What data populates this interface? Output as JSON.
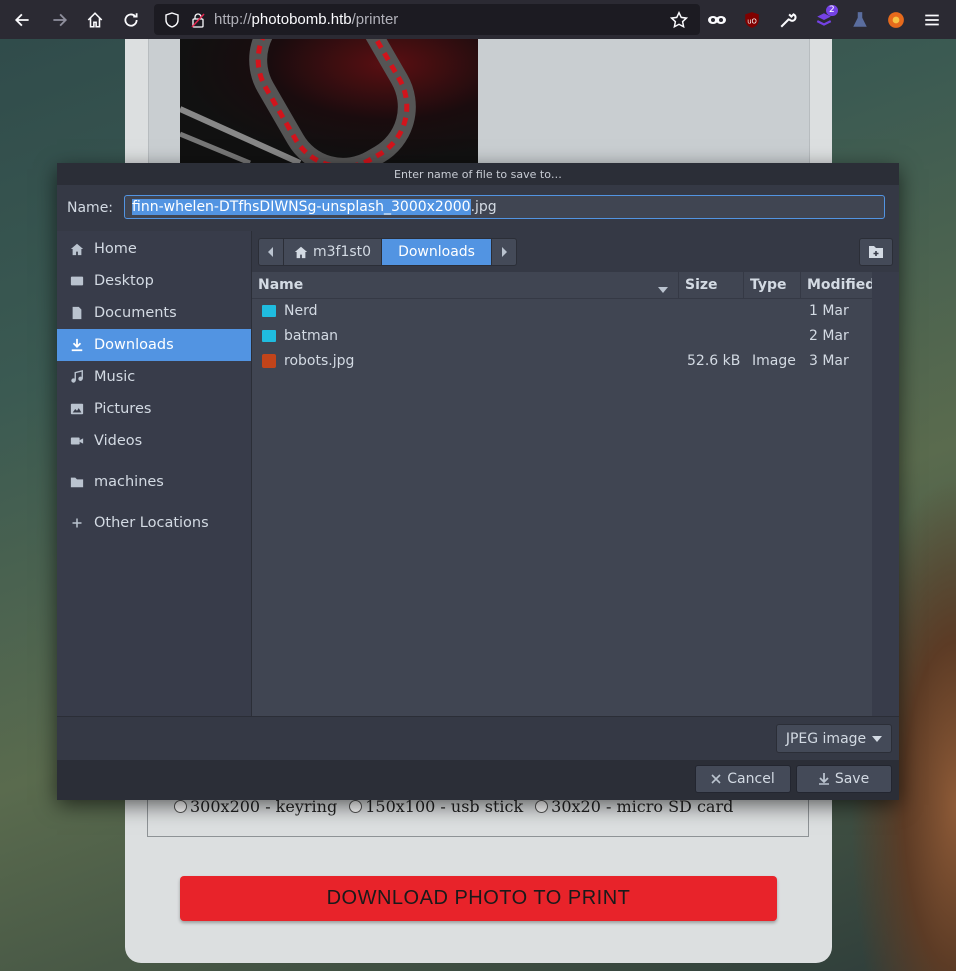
{
  "browser": {
    "url_prefix": "http://",
    "url_host": "photobomb.htb",
    "url_path": "/printer",
    "extension_badge": "2"
  },
  "page": {
    "options": [
      "300x200 - keyring",
      "150x100 - usb stick",
      "30x20 - micro SD card"
    ],
    "download_button": "DOWNLOAD PHOTO TO PRINT"
  },
  "dialog": {
    "title": "Enter name of file to save to…",
    "name_label": "Name:",
    "filename_selected": "finn-whelen-DTfhsDIWNSg-unsplash_3000x2000",
    "filename_ext": ".jpg",
    "sidebar": [
      {
        "label": "Home",
        "icon": "home-icon"
      },
      {
        "label": "Desktop",
        "icon": "desktop-icon"
      },
      {
        "label": "Documents",
        "icon": "document-icon"
      },
      {
        "label": "Downloads",
        "icon": "download-icon",
        "active": true
      },
      {
        "label": "Music",
        "icon": "music-icon"
      },
      {
        "label": "Pictures",
        "icon": "pictures-icon"
      },
      {
        "label": "Videos",
        "icon": "videos-icon"
      },
      {
        "label": "machines",
        "icon": "folder-icon"
      },
      {
        "label": "Other Locations",
        "icon": "plus-icon"
      }
    ],
    "breadcrumb": {
      "home": "m3f1st0",
      "current": "Downloads"
    },
    "columns": {
      "name": "Name",
      "size": "Size",
      "type": "Type",
      "modified": "Modified"
    },
    "files": [
      {
        "name": "Nerd",
        "size": "",
        "type": "",
        "modified": "1 Mar",
        "kind": "folder"
      },
      {
        "name": "batman",
        "size": "",
        "type": "",
        "modified": "2 Mar",
        "kind": "folder"
      },
      {
        "name": "robots.jpg",
        "size": "52.6 kB",
        "type": "Image",
        "modified": "3 Mar",
        "kind": "image"
      }
    ],
    "filter": "JPEG image",
    "cancel": "Cancel",
    "save": "Save"
  },
  "colors": {
    "accent": "#5294e2",
    "download_red": "#e8232a",
    "folder": "#1fbcdf"
  }
}
